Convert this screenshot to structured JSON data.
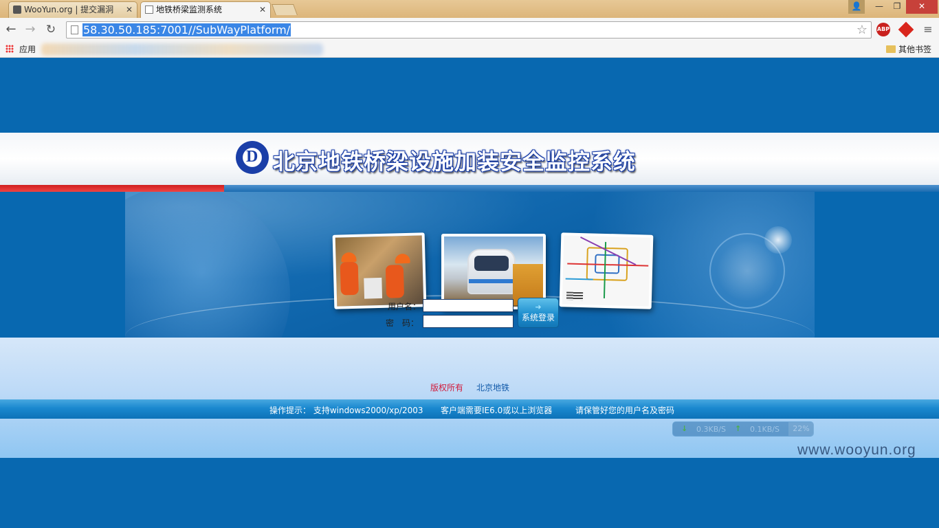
{
  "browser": {
    "tabs": [
      {
        "title": "WooYun.org | 提交漏洞",
        "active": false
      },
      {
        "title": "地铁桥梁监测系统",
        "active": true
      }
    ],
    "window_buttons": {
      "user": "👤",
      "minimize": "—",
      "maximize": "❐",
      "close": "✕"
    },
    "close_glyph": "✕",
    "url": "58.30.50.185:7001//SubWayPlatform/",
    "bookmarks": {
      "apps": "应用",
      "other": "其他书签"
    },
    "extensions": [
      "abp-icon",
      "red-diamond-icon",
      "menu-icon"
    ],
    "abp_label": "ABP"
  },
  "page": {
    "title": "北京地铁桥梁设施加装安全监控系统",
    "logo_letter": "D",
    "login": {
      "username_label": "用户名：",
      "password_label": "密　码：",
      "username_value": "",
      "password_value": "",
      "button_label": "系统登录",
      "button_icon": "➜"
    },
    "footer_links": {
      "copyright": "版权所有",
      "company": "北京地铁"
    },
    "tips": [
      "操作提示： 支持windows2000/xp/2003",
      "客户端需要IE6.0或以上浏览器",
      "请保管好您的用户名及密码"
    ]
  },
  "overlay": {
    "download_speed": "0.3KB/S",
    "upload_speed": "0.1KB/S",
    "cpu": "22%",
    "watermark": "www.wooyun.org"
  },
  "colors": {
    "page_bg": "#0868b0",
    "title_outline": "#1b3fa8",
    "accent_red": "#d02020",
    "copyright_text": "#d21a3a"
  }
}
